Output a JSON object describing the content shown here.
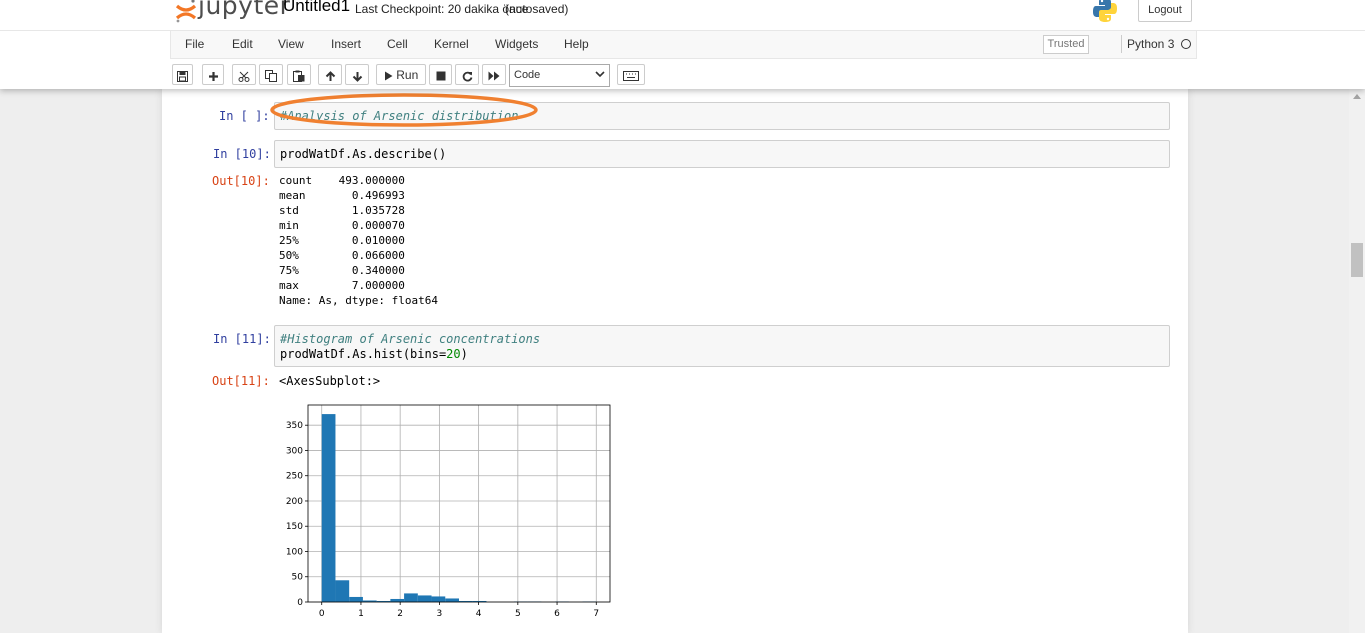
{
  "header": {
    "logo_text": "jupyter",
    "notebook_name": "Untitled1",
    "checkpoint": "Last Checkpoint: 20 dakika önce",
    "autosave": "(autosaved)",
    "logout_label": "Logout"
  },
  "menu": {
    "items": [
      "File",
      "Edit",
      "View",
      "Insert",
      "Cell",
      "Kernel",
      "Widgets",
      "Help"
    ],
    "trusted_label": "Trusted",
    "kernel_name": "Python 3"
  },
  "toolbar": {
    "run_label": "Run",
    "cell_type": "Code"
  },
  "cells": [
    {
      "prompt": "In [ ]:",
      "lines": [
        "#Analysis of Arsenic distribution"
      ]
    },
    {
      "prompt": "In [10]:",
      "lines": [
        "prodWatDf.As.describe()"
      ],
      "out_prompt": "Out[10]:",
      "output": "count    493.000000\nmean       0.496993\nstd        1.035728\nmin        0.000070\n25%        0.010000\n50%        0.066000\n75%        0.340000\nmax        7.000000\nName: As, dtype: float64"
    },
    {
      "prompt": "In [11]:",
      "lines": [
        "#Histogram of Arsenic concentrations",
        "prodWatDf.As.hist(bins=",
        "20",
        ")"
      ],
      "out_prompt": "Out[11]:",
      "output": "<AxesSubplot:>"
    }
  ],
  "colors": {
    "bar": "#1f77b4",
    "prompt_in": "#303f9f",
    "prompt_out": "#d84315",
    "highlight": "#f08030"
  },
  "chart_data": {
    "type": "bar",
    "x_bin_edges": [
      7e-05,
      0.35,
      0.7,
      1.05,
      1.4,
      1.75,
      2.1,
      2.45,
      2.8,
      3.15,
      3.5,
      3.85,
      4.2,
      4.55,
      4.9,
      5.25,
      5.6,
      5.95,
      6.3,
      6.65,
      7.0
    ],
    "values": [
      372,
      43,
      10,
      3,
      2,
      6,
      17,
      13,
      11,
      7,
      2,
      2,
      0,
      0,
      1,
      1,
      0,
      1,
      0,
      1
    ],
    "xlim": [
      -0.35,
      7.35
    ],
    "ylim": [
      0,
      390
    ],
    "xticks": [
      "0",
      "1",
      "2",
      "3",
      "4",
      "5",
      "6",
      "7"
    ],
    "yticks": [
      "0",
      "50",
      "100",
      "150",
      "200",
      "250",
      "300",
      "350"
    ],
    "grid": true
  }
}
